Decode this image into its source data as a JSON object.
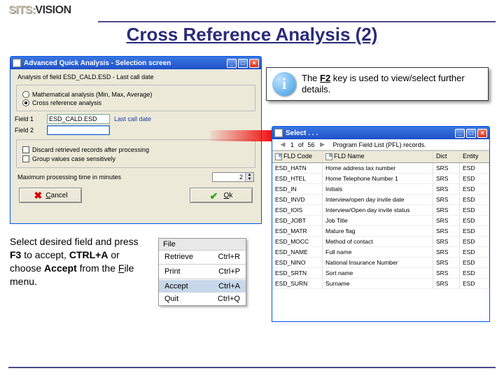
{
  "logo": {
    "left": "SITS:",
    "right": "VISION"
  },
  "title": "Cross Reference Analysis (2)",
  "callout": {
    "pre": "The ",
    "key": "F2",
    "post": " key is used to view/select further details."
  },
  "win1": {
    "title": "Advanced Quick Analysis - Selection screen",
    "subtitle": "Analysis of field ESD_CALD.ESD - Last call date",
    "radio_math": "Mathematical analysis (Min, Max, Average)",
    "radio_cross": "Cross reference analysis",
    "field1_label": "Field 1",
    "field1_value": "ESD_CALD.ESD",
    "field1_desc": "Last call date",
    "field2_label": "Field 2",
    "field2_value": "",
    "chk_discard": "Discard retrieved records after processing",
    "chk_group": "Group values case sensitively",
    "min_label": "Maximum processing time in minutes",
    "min_value": "2",
    "btn_cancel": "Cancel",
    "btn_ok": "Ok"
  },
  "win2": {
    "title": "Select . . .",
    "pager": {
      "page": "1",
      "of_label": "of",
      "pages": "56",
      "summary": "Program Field List (PFL) records."
    },
    "cols": {
      "code": "FLD Code",
      "name": "FLD Name",
      "dict": "Dict",
      "ent": "Entity"
    },
    "rows": [
      {
        "code": "ESD_HATN",
        "name": "Home address tax number",
        "dict": "SRS",
        "ent": "ESD"
      },
      {
        "code": "ESD_HTEL",
        "name": "Home Telephone Number 1",
        "dict": "SRS",
        "ent": "ESD"
      },
      {
        "code": "ESD_IN",
        "name": "Initials",
        "dict": "SRS",
        "ent": "ESD"
      },
      {
        "code": "ESD_INVD",
        "name": "Interview/open day invite date",
        "dict": "SRS",
        "ent": "ESD"
      },
      {
        "code": "ESD_IOIS",
        "name": "Interview/Open day invite status",
        "dict": "SRS",
        "ent": "ESD"
      },
      {
        "code": "ESD_JOBT",
        "name": "Job Title",
        "dict": "SRS",
        "ent": "ESD"
      },
      {
        "code": "ESD_MATR",
        "name": "Mature flag",
        "dict": "SRS",
        "ent": "ESD"
      },
      {
        "code": "ESD_MOCC",
        "name": "Method of contact",
        "dict": "SRS",
        "ent": "ESD"
      },
      {
        "code": "ESD_NAME",
        "name": "Full name",
        "dict": "SRS",
        "ent": "ESD"
      },
      {
        "code": "ESD_NINO",
        "name": "National Insurance Number",
        "dict": "SRS",
        "ent": "ESD"
      },
      {
        "code": "ESD_SRTN",
        "name": "Sort name",
        "dict": "SRS",
        "ent": "ESD"
      },
      {
        "code": "ESD_SURN",
        "name": "Surname",
        "dict": "SRS",
        "ent": "ESD"
      }
    ]
  },
  "instr": {
    "l1a": "Select desired field and press ",
    "key_f3": "F3",
    "l1b": " to accept, ",
    "key_ctrl": "CTRL+A",
    "l1c": " or choose ",
    "key_accept": "Accept",
    "l1d": " from the ",
    "file_u": "F",
    "file_rest": "ile",
    "l1e": " menu."
  },
  "menu": {
    "title": "File",
    "items": [
      {
        "label": "Retrieve",
        "accel": "Ctrl+R"
      },
      {
        "label": "Print",
        "accel": "Ctrl+P"
      },
      {
        "label": "Accept",
        "accel": "Ctrl+A"
      },
      {
        "label": "Quit",
        "accel": "Ctrl+Q"
      }
    ]
  }
}
